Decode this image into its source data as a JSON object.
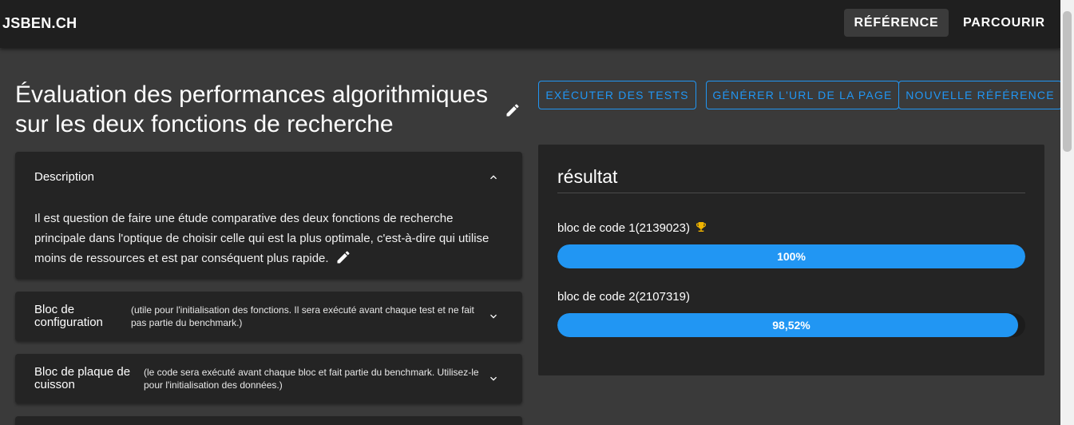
{
  "header": {
    "brand": "JSBEN.CH",
    "nav": {
      "reference": "RÉFÉRENCE",
      "browse": "PARCOURIR"
    }
  },
  "page": {
    "title": "Évaluation des performances algorithmiques sur les deux fonctions de recherche"
  },
  "actions": {
    "run_tests": "EXÉCUTER DES TESTS",
    "generate_url": "GÉNÉRER L'URL DE LA PAGE",
    "new_benchmark": "NOUVELLE RÉFÉRENCE"
  },
  "description": {
    "heading": "Description",
    "body": "Il est question de faire une étude comparative des deux fonctions de recherche principale dans l'optique de choisir celle qui est la plus optimale, c'est-à-dire qui utilise moins de ressources et est par conséquent plus rapide."
  },
  "accordions": [
    {
      "title": "Bloc de configuration",
      "hint": "(utile pour l'initialisation des fonctions. Il sera exécuté avant chaque test et ne fait pas partie du benchmark.)"
    },
    {
      "title": "Bloc de plaque de cuisson",
      "hint": "(le code sera exécuté avant chaque bloc et fait partie du benchmark. Utilisez-le pour l'initialisation des données.)"
    }
  ],
  "result": {
    "title": "résultat",
    "blocks": [
      {
        "label": "bloc de code 1(2139023)",
        "percent_text": "100%",
        "percent": 100,
        "winner": true
      },
      {
        "label": "bloc de code 2(2107319)",
        "percent_text": "98,52%",
        "percent": 98.52,
        "winner": false
      }
    ]
  },
  "colors": {
    "accent": "#2196f3",
    "appbar": "#1f1f1f",
    "card": "#242424",
    "background": "#3a3a3a"
  },
  "icons": {
    "edit": "pencil-icon",
    "expand": "chevron-icon",
    "winner": "trophy-icon"
  }
}
